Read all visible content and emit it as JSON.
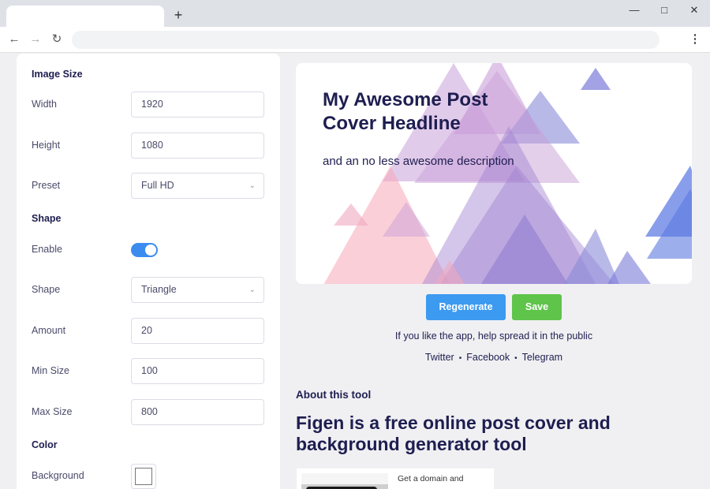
{
  "browser": {
    "new_tab_symbol": "+",
    "window_controls": [
      "minimize-icon",
      "maximize-icon",
      "close-icon"
    ],
    "nav_icons": [
      "back-icon",
      "forward-icon",
      "reload-icon",
      "menu-icon"
    ]
  },
  "settings": {
    "image_size_title": "Image Size",
    "width_label": "Width",
    "width_value": "1920",
    "height_label": "Height",
    "height_value": "1080",
    "preset_label": "Preset",
    "preset_value": "Full HD",
    "shape_title": "Shape",
    "enable_label": "Enable",
    "enable_on": true,
    "shape_label": "Shape",
    "shape_value": "Triangle",
    "amount_label": "Amount",
    "amount_value": "20",
    "min_size_label": "Min Size",
    "min_size_value": "100",
    "max_size_label": "Max Size",
    "max_size_value": "800",
    "color_title": "Color",
    "background_label": "Background",
    "background_color": "#ffffff"
  },
  "preview": {
    "headline": "My Awesome Post Cover Headline",
    "description": "and an no less awesome description"
  },
  "actions": {
    "regenerate_label": "Regenerate",
    "save_label": "Save"
  },
  "share": {
    "text": "If you like the app, help spread it in the public",
    "links": [
      "Twitter",
      "Facebook",
      "Telegram"
    ]
  },
  "about": {
    "label": "About this tool",
    "heading": "Figen is a free online post cover and background generator tool",
    "ad_text": "Get a domain and"
  },
  "colors": {
    "accent_blue": "#3c9af0",
    "save_green": "#5fc44a",
    "toggle_blue": "#3c8cf0",
    "text_dark": "#1e1e50"
  }
}
